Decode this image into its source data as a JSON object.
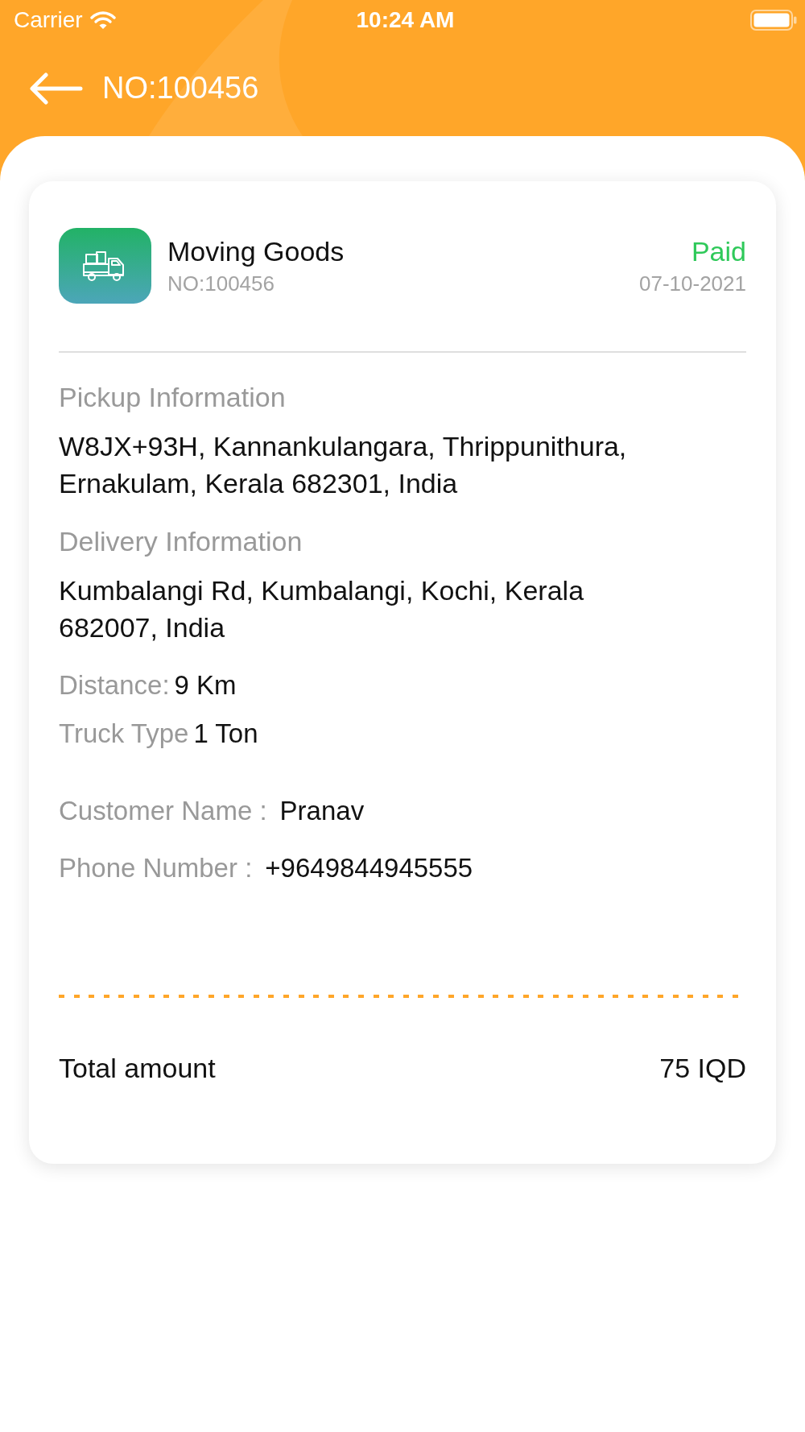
{
  "status_bar": {
    "carrier": "Carrier",
    "time": "10:24 AM"
  },
  "header": {
    "title": "NO:100456"
  },
  "order": {
    "service": "Moving Goods",
    "number": "NO:100456",
    "payment": {
      "label": "Paid",
      "paid": true
    },
    "date": "07-10-2021"
  },
  "sections": [
    {
      "label": "Pickup Information",
      "address": "W8JX+93H, Kannankulangara, Thrippunithura, Ernakulam, Kerala 682301, India"
    },
    {
      "label": "Delivery Information",
      "address": "Kumbalangi Rd, Kumbalangi, Kochi, Kerala 682007, India"
    }
  ],
  "details": [
    {
      "label": "Distance:",
      "value": "9 Km"
    },
    {
      "label": "Truck Type",
      "value": "1 Ton"
    }
  ],
  "customer": [
    {
      "label": "Customer Name :",
      "value": "Pranav"
    },
    {
      "label": "Phone Number :",
      "value": "+9649844945555"
    }
  ],
  "total": {
    "label": "Total amount",
    "value": "75 IQD"
  }
}
